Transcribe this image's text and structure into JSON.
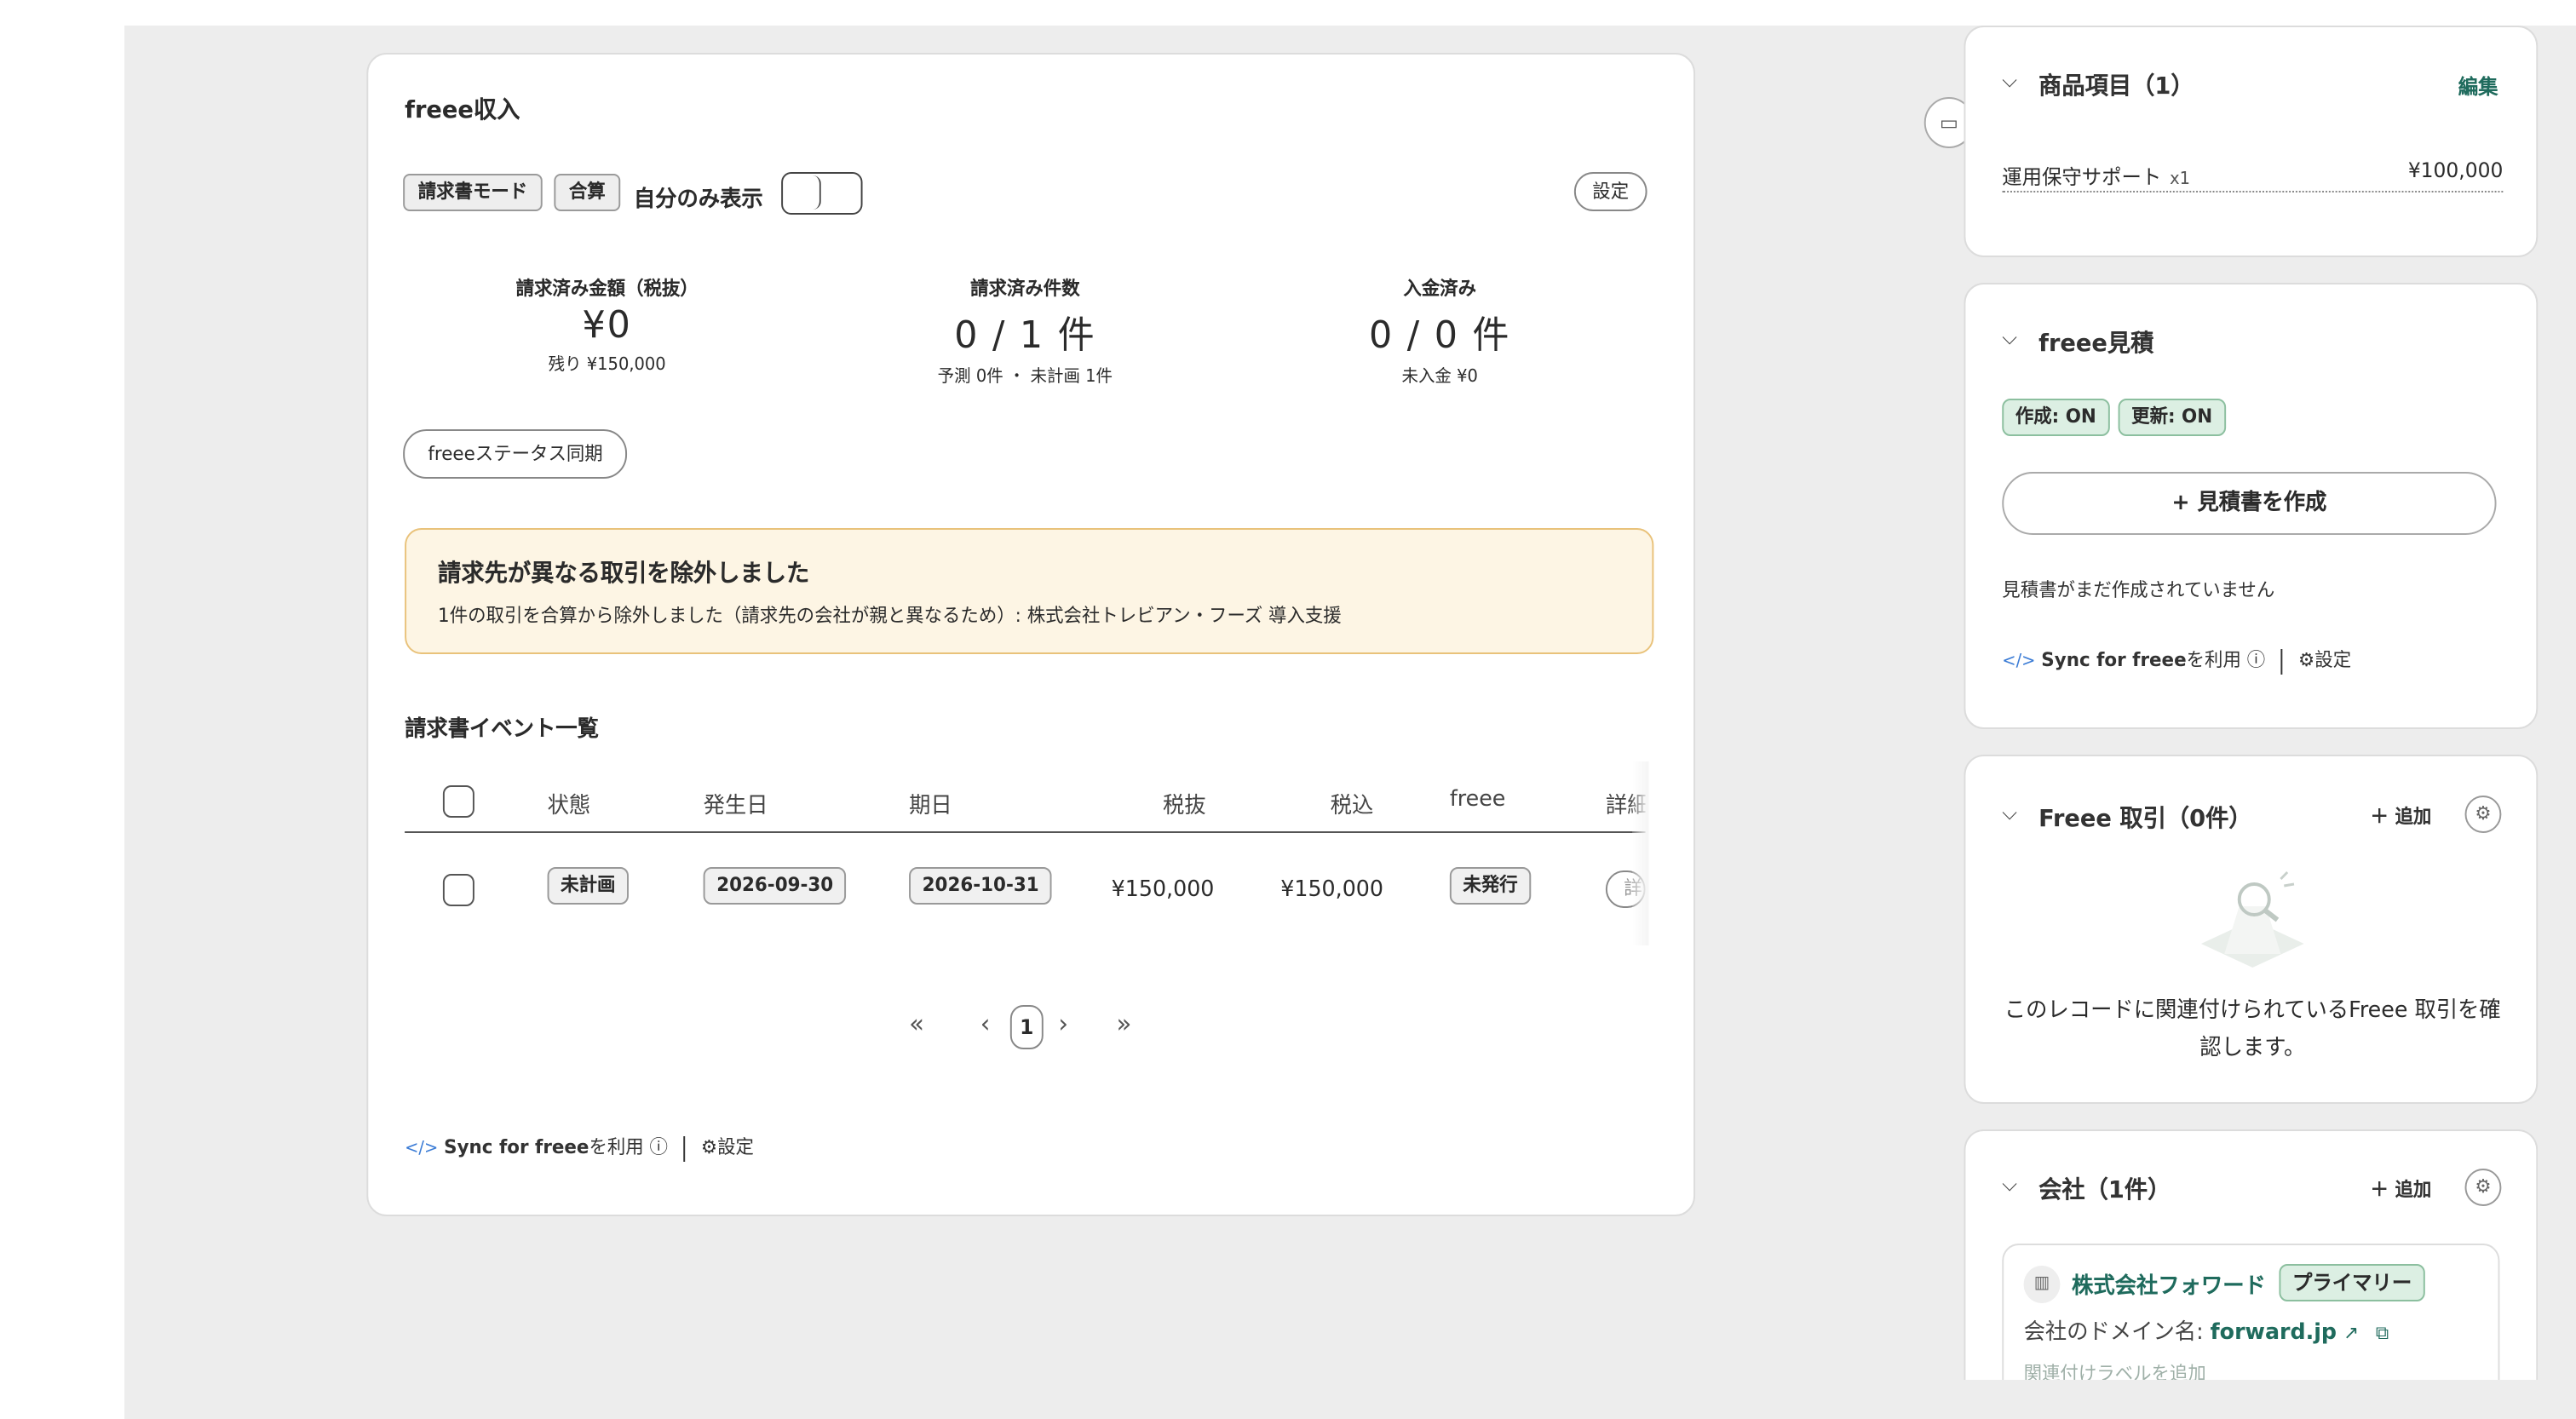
{
  "main": {
    "title": "freee収入",
    "mode_chip": "請求書モード",
    "sum_chip": "合算",
    "self_only_label": "自分のみ表示",
    "settings_button": "設定",
    "stats": [
      {
        "label": "請求済み金額（税抜）",
        "value": "¥0",
        "sub": "残り ¥150,000"
      },
      {
        "label": "請求済み件数",
        "value": "0 / 1 件",
        "sub": "予測 0件 ・ 未計画 1件"
      },
      {
        "label": "入金済み",
        "value": "0 / 0 件",
        "sub": "未入金 ¥0"
      }
    ],
    "sync_status_button": "freeeステータス同期",
    "warning": {
      "title": "請求先が異なる取引を除外しました",
      "detail": "1件の取引を合算から除外しました（請求先の会社が親と異なるため）: 株式会社トレビアン・フーズ 導入支援"
    },
    "events_title": "請求書イベント一覧",
    "table": {
      "headers": [
        "状態",
        "発生日",
        "期日",
        "税抜",
        "税込",
        "freee",
        "詳細"
      ],
      "rows": [
        {
          "status": "未計画",
          "issue_date": "2026-09-30",
          "due_date": "2026-10-31",
          "excl_tax": "¥150,000",
          "incl_tax": "¥150,000",
          "freee": "未発行",
          "detail": "詳"
        }
      ]
    },
    "pagination": {
      "first": "«",
      "prev": "‹",
      "current": "1",
      "next": "›",
      "last": "»"
    },
    "sync": {
      "code_icon": "</>",
      "label_bold": "Sync for freee",
      "label_rest": "を利用",
      "info_icon": "ⓘ",
      "settings_label": "設定"
    }
  },
  "panels": {
    "products": {
      "title": "商品項目（1）",
      "edit": "編集",
      "item_name": "運用保守サポート",
      "item_qty": "x1",
      "item_price": "¥100,000"
    },
    "estimate": {
      "title": "freee見積",
      "tag_create": "作成: ON",
      "tag_update": "更新: ON",
      "create_button": "+ 見積書を作成",
      "empty_text": "見積書がまだ作成されていません",
      "sync_bold": "Sync for freee",
      "sync_rest": "を利用",
      "settings_label": "設定"
    },
    "deals": {
      "title": "Freee 取引（0件）",
      "add": "追加",
      "empty_line1": "このレコードに関連付けられているFreee 取引を確",
      "empty_line2": "認します。"
    },
    "company": {
      "title": "会社（1件）",
      "add": "追加",
      "name": "株式会社フォワード",
      "primary_badge": "プライマリー",
      "domain_label": "会社のドメイン名: ",
      "domain_value": "forward.jp",
      "add_label": "関連付けラベルを追加"
    }
  },
  "icons": {
    "chevron": "chevron-down-icon",
    "gear": "gear-icon",
    "plus": "plus-icon",
    "external": "external-link-icon",
    "copy": "copy-icon",
    "sidebar": "sidebar-toggle-icon"
  },
  "colors": {
    "accent_green": "#1f6b5d",
    "warning_bg": "#fdf5e4",
    "warning_border": "#e9c27a",
    "tag_green_bg": "#dcefe3"
  }
}
